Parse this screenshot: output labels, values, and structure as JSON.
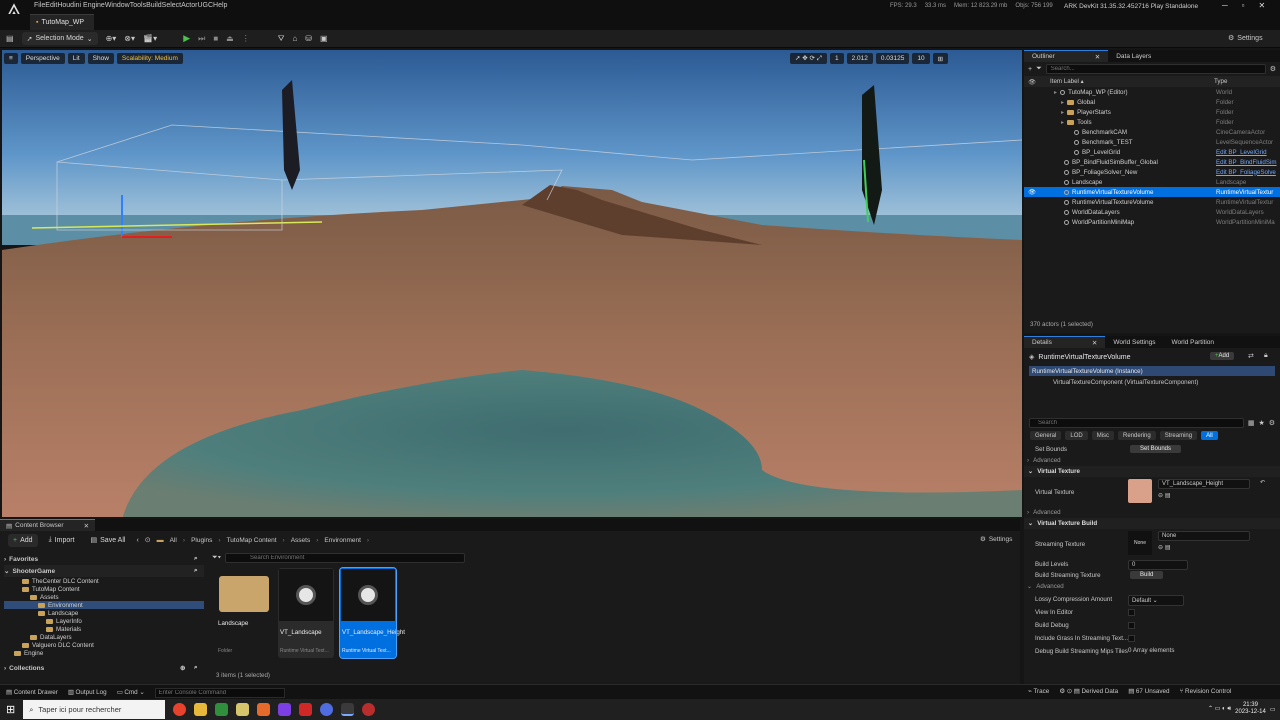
{
  "menu": [
    "File",
    "Edit",
    "Houdini Engine",
    "Window",
    "Tools",
    "Build",
    "Select",
    "Actor",
    "UGC",
    "Help"
  ],
  "perf": {
    "fps": "FPS: 29.3",
    "ms": "33.3 ms",
    "mem": "Mem: 12 823.29 mb",
    "objs": "Objs: 756 199"
  },
  "devkit": "ARK DevKit 31.35.32.452716  Play Standalone",
  "map_tab": "TutoMap_WP",
  "toolbar": {
    "mode": "Selection Mode",
    "settings": "Settings"
  },
  "viewport": {
    "perspective": "Perspective",
    "lit": "Lit",
    "show": "Show",
    "scalability": "Scalability: Medium",
    "grid": "1",
    "snap1": "2.012",
    "snap2": "0.03125",
    "cam": "10"
  },
  "outliner": {
    "tab1": "Outliner",
    "tab2": "Data Layers",
    "search_placeholder": "Search...",
    "col_label": "Item Label ▴",
    "col_type": "Type",
    "rows": [
      {
        "label": "TutoMap_WP (Editor)",
        "type": "World",
        "indent": 30,
        "kind": "world"
      },
      {
        "label": "Global",
        "type": "Folder",
        "indent": 37,
        "kind": "folder"
      },
      {
        "label": "PlayerStarts",
        "type": "Folder",
        "indent": 37,
        "kind": "folder"
      },
      {
        "label": "Tools",
        "type": "Folder",
        "indent": 37,
        "kind": "folder"
      },
      {
        "label": "BenchmarkCAM",
        "type": "CineCameraActor",
        "indent": 47,
        "kind": "actor"
      },
      {
        "label": "Benchmark_TEST",
        "type": "LevelSequenceActor",
        "indent": 47,
        "kind": "actor"
      },
      {
        "label": "BP_LevelGrid",
        "type": "Edit BP_LevelGrid",
        "indent": 47,
        "kind": "actor",
        "link": true
      },
      {
        "label": "BP_BindFluidSimBuffer_Global",
        "type": "Edit BP_BindFluidSim",
        "indent": 37,
        "kind": "actor",
        "link": true
      },
      {
        "label": "BP_FoliageSolver_New",
        "type": "Edit BP_FoliageSolve",
        "indent": 37,
        "kind": "actor",
        "link": true
      },
      {
        "label": "Landscape",
        "type": "Landscape",
        "indent": 37,
        "kind": "actor"
      },
      {
        "label": "RuntimeVirtualTextureVolume",
        "type": "RuntimeVirtualTextur",
        "indent": 37,
        "kind": "actor",
        "sel": true
      },
      {
        "label": "RuntimeVirtualTextureVolume",
        "type": "RuntimeVirtualTextur",
        "indent": 37,
        "kind": "actor"
      },
      {
        "label": "WorldDataLayers",
        "type": "WorldDataLayers",
        "indent": 37,
        "kind": "actor"
      },
      {
        "label": "WorldPartitionMiniMap",
        "type": "WorldPartitionMiniMa",
        "indent": 37,
        "kind": "actor"
      }
    ],
    "footer": "370 actors (1 selected)"
  },
  "details": {
    "tab1": "Details",
    "tab2": "World Settings",
    "tab3": "World Partition",
    "title": "RuntimeVirtualTextureVolume",
    "add": "Add",
    "instance": "RuntimeVirtualTextureVolume (Instance)",
    "component": "VirtualTextureComponent (VirtualTextureComponent)",
    "search_placeholder": "Search",
    "filters": [
      "General",
      "LOD",
      "Misc",
      "Rendering",
      "Streaming",
      "All"
    ],
    "set_bounds_label": "Set Bounds",
    "set_bounds_btn": "Set Bounds",
    "advanced": "Advanced",
    "sec_vt": "Virtual Texture",
    "vt_label": "Virtual Texture",
    "vt_value": "VT_Landscape_Height",
    "sec_build": "Virtual Texture Build",
    "streaming_label": "Streaming Texture",
    "streaming_value": "None",
    "none_thumb": "None",
    "build_levels_label": "Build Levels",
    "build_levels_value": "0",
    "build_stream_label": "Build Streaming Texture",
    "build_btn": "Build",
    "lossy_label": "Lossy Compression Amount",
    "lossy_value": "Default",
    "view_editor": "View In Editor",
    "build_debug": "Build Debug",
    "grass": "Include Grass In Streaming Text...",
    "debug_tiles": "Debug Build Streaming Mips Tiles",
    "debug_tiles_value": "0 Array elements"
  },
  "cb": {
    "tab": "Content Browser",
    "add": "Add",
    "import": "Import",
    "saveall": "Save All",
    "crumbs": [
      "All",
      "Plugins",
      "TutoMap Content",
      "Assets",
      "Environment"
    ],
    "settings": "Settings",
    "favorites": "Favorites",
    "shooter": "ShooterGame",
    "search_placeholder": "Search Environment",
    "tree": [
      {
        "label": "TheCenter DLC Content",
        "indent": 18
      },
      {
        "label": "TutoMap Content",
        "indent": 18
      },
      {
        "label": "Assets",
        "indent": 26
      },
      {
        "label": "Environment",
        "indent": 34,
        "sel": true
      },
      {
        "label": "Landscape",
        "indent": 34
      },
      {
        "label": "LayerInfo",
        "indent": 42
      },
      {
        "label": "Materials",
        "indent": 42
      },
      {
        "label": "DataLayers",
        "indent": 26
      },
      {
        "label": "Valguero DLC Content",
        "indent": 18
      },
      {
        "label": "Engine",
        "indent": 10
      }
    ],
    "collections": "Collections",
    "tiles": [
      {
        "name": "Landscape",
        "sub": "Folder",
        "kind": "folder"
      },
      {
        "name": "VT_Landscape",
        "sub": "Runtime Virtual Text...",
        "kind": "asset"
      },
      {
        "name": "VT_Landscape_Height",
        "sub": "Runtime Virtual Text...",
        "kind": "asset",
        "sel": true
      }
    ],
    "count": "3 items (1 selected)"
  },
  "status": {
    "drawer": "Content Drawer",
    "output": "Output Log",
    "cmd": "Cmd",
    "console_placeholder": "Enter Console Command",
    "trace": "Trace",
    "derived": "Derived Data",
    "unsaved": "67 Unsaved",
    "revision": "Revision Control"
  },
  "taskbar": {
    "search_placeholder": "Taper ici pour rechercher",
    "time": "21:39",
    "date": "2023-12-14"
  }
}
